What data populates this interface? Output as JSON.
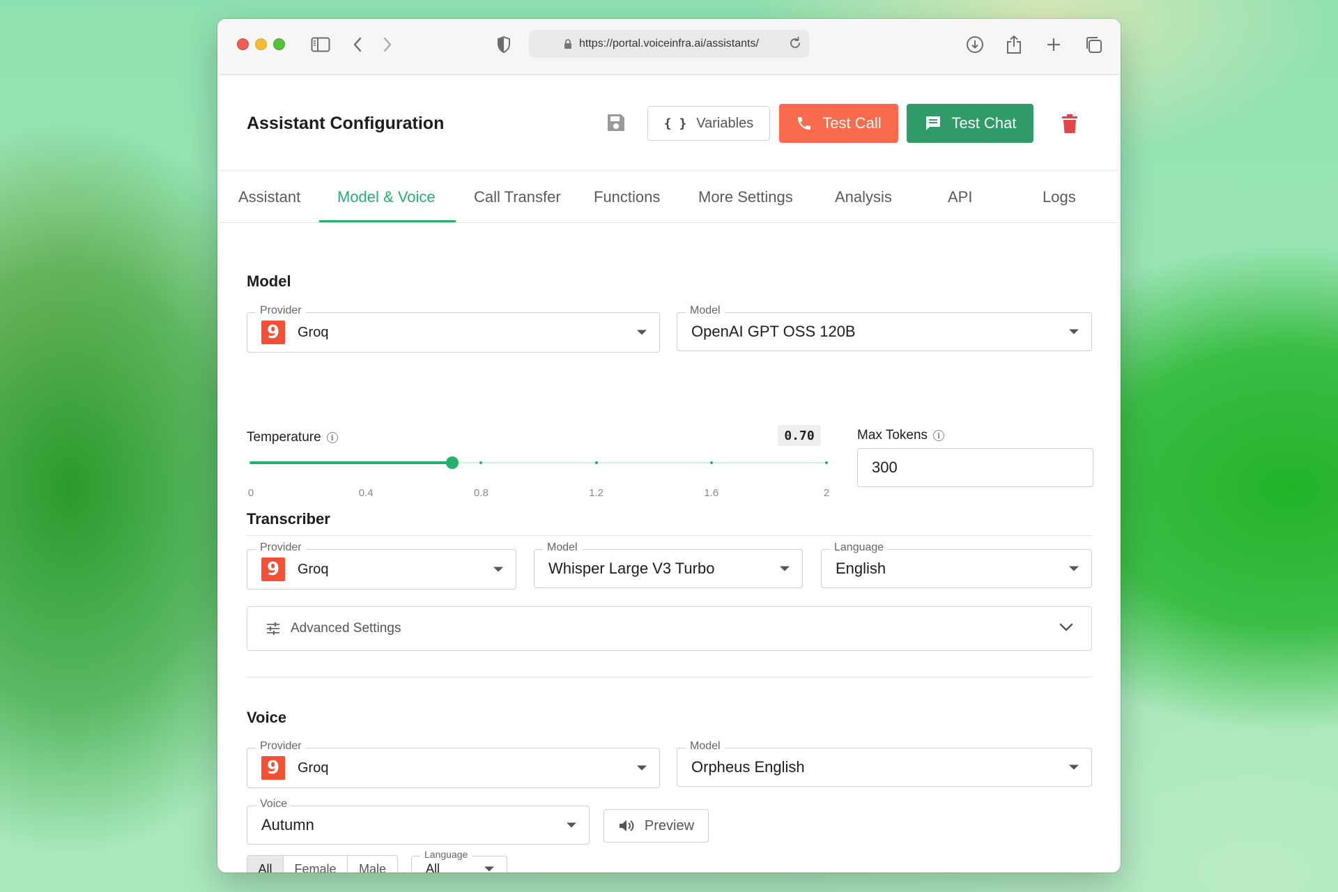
{
  "browser": {
    "url": "https://portal.voiceinfra.ai/assistants/"
  },
  "header": {
    "title": "Assistant Configuration",
    "variables_label": "Variables",
    "test_call_label": "Test Call",
    "test_chat_label": "Test Chat"
  },
  "tabs": [
    {
      "label": "Assistant"
    },
    {
      "label": "Model & Voice",
      "active": true
    },
    {
      "label": "Call Transfer"
    },
    {
      "label": "Functions"
    },
    {
      "label": "More Settings"
    },
    {
      "label": "Analysis"
    },
    {
      "label": "API"
    },
    {
      "label": "Logs"
    }
  ],
  "model": {
    "section_title": "Model",
    "provider_label": "Provider",
    "provider_value": "Groq",
    "model_label": "Model",
    "model_value": "OpenAI GPT OSS 120B",
    "temperature_label": "Temperature",
    "temperature_value": "0.70",
    "temperature_number": 0.7,
    "temperature_min": 0,
    "temperature_max": 2,
    "slider_ticks": [
      "0",
      "0.4",
      "0.8",
      "1.2",
      "1.6",
      "2"
    ],
    "max_tokens_label": "Max Tokens",
    "max_tokens_value": "300"
  },
  "transcriber": {
    "section_title": "Transcriber",
    "provider_label": "Provider",
    "provider_value": "Groq",
    "model_label": "Model",
    "model_value": "Whisper Large V3 Turbo",
    "language_label": "Language",
    "language_value": "English",
    "advanced_label": "Advanced Settings"
  },
  "voice": {
    "section_title": "Voice",
    "provider_label": "Provider",
    "provider_value": "Groq",
    "model_label": "Model",
    "model_value": "Orpheus English",
    "voice_label": "Voice",
    "voice_value": "Autumn",
    "preview_label": "Preview",
    "filters": [
      "All",
      "Female",
      "Male"
    ],
    "language_label": "Language",
    "language_value": "All"
  },
  "icons": {
    "provider_logo_glyph": "9"
  },
  "colors": {
    "accent_green": "#22b06a",
    "test_call": "#fa6a4d",
    "test_chat": "#2f9b68",
    "delete": "#e0454b",
    "groq_logo": "#f54f36"
  }
}
